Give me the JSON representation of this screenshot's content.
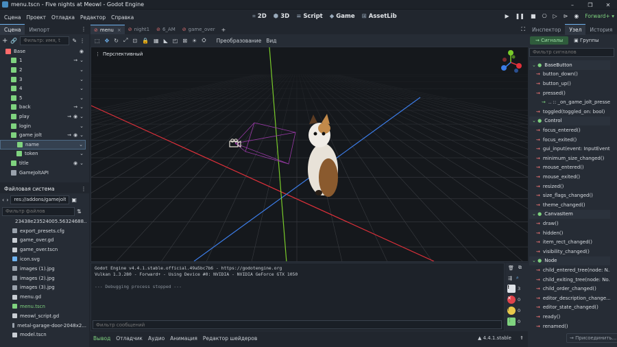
{
  "window": {
    "title": "menu.tscn - Five nights at Meowl - Godot Engine",
    "controls": [
      "–",
      "❐",
      "✕"
    ]
  },
  "menu": [
    "Сцена",
    "Проект",
    "Отладка",
    "Редактор",
    "Справка"
  ],
  "workspaces": [
    {
      "icon": "⌗",
      "label": "2D"
    },
    {
      "icon": "⬢",
      "label": "3D"
    },
    {
      "icon": "≡",
      "label": "Script"
    },
    {
      "icon": "◆",
      "label": "Game"
    },
    {
      "icon": "⊞",
      "label": "AssetLib"
    }
  ],
  "renderer": "Forward+",
  "scene_dock": {
    "tabs": [
      "Сцена",
      "Импорт"
    ],
    "filter_placeholder": "Фильтр: имя, t",
    "nodes": [
      {
        "label": "Base",
        "indent": 0,
        "color": "#ff6b6b",
        "sel": false
      },
      {
        "label": "1",
        "indent": 1,
        "color": "#7fd37f",
        "sel": false
      },
      {
        "label": "2",
        "indent": 1,
        "color": "#7fd37f",
        "sel": false
      },
      {
        "label": "3",
        "indent": 1,
        "color": "#7fd37f",
        "sel": false
      },
      {
        "label": "4",
        "indent": 1,
        "color": "#7fd37f",
        "sel": false
      },
      {
        "label": "5",
        "indent": 1,
        "color": "#7fd37f",
        "sel": false
      },
      {
        "label": "back",
        "indent": 1,
        "color": "#7fd37f",
        "sel": false
      },
      {
        "label": "play",
        "indent": 1,
        "color": "#7fd37f",
        "sel": false
      },
      {
        "label": "login",
        "indent": 1,
        "color": "#7fd37f",
        "sel": false
      },
      {
        "label": "game jolt",
        "indent": 1,
        "color": "#7fd37f",
        "sel": false
      },
      {
        "label": "name",
        "indent": 2,
        "color": "#7fd37f",
        "sel": true
      },
      {
        "label": "token",
        "indent": 2,
        "color": "#7fd37f",
        "sel": false
      },
      {
        "label": "title",
        "indent": 1,
        "color": "#7fd37f",
        "sel": false
      },
      {
        "label": "GameJoltAPI",
        "indent": 1,
        "color": "#9aa2ac",
        "sel": false
      }
    ]
  },
  "filesystem": {
    "title": "Файловая система",
    "path": "res://addons/gamejolt_api",
    "filter_placeholder": "Фильтр файлов",
    "files": [
      {
        "label": "23438e23524005.56324688...",
        "color": "#e06c75"
      },
      {
        "label": "export_presets.cfg",
        "color": "#9aa2ac"
      },
      {
        "label": "game_over.gd",
        "color": "#c9ced4"
      },
      {
        "label": "game_over.tscn",
        "color": "#c9ced4"
      },
      {
        "label": "icon.svg",
        "color": "#6fb3f0"
      },
      {
        "label": "images (1).jpg",
        "color": "#9aa2ac"
      },
      {
        "label": "images (2).jpg",
        "color": "#9aa2ac"
      },
      {
        "label": "images (3).jpg",
        "color": "#9aa2ac"
      },
      {
        "label": "menu.gd",
        "color": "#c9ced4"
      },
      {
        "label": "menu.tscn",
        "color": "#7fd37f"
      },
      {
        "label": "meowl_script.gd",
        "color": "#c9ced4"
      },
      {
        "label": "metal-garage-door-2048x2...",
        "color": "#9aa2ac"
      },
      {
        "label": "model.tscn",
        "color": "#c9ced4"
      }
    ]
  },
  "editor_tabs": [
    {
      "label": "menu",
      "active": true
    },
    {
      "label": "night1",
      "active": false
    },
    {
      "label": "6_AM",
      "active": false
    },
    {
      "label": "game_over",
      "active": false
    }
  ],
  "toolbar": {
    "transform": "Преобразование",
    "view": "Вид"
  },
  "viewport": {
    "label": "Перспективный"
  },
  "output": {
    "lines": [
      "Godot Engine v4.4.1.stable.official.49a5bc7b6 - https://godotengine.org",
      "Vulkan 1.3.280 - Forward+ - Using Device #0: NVIDIA - NVIDIA GeForce GTX 1050",
      "",
      "--- Debugging process stopped ---"
    ],
    "filter_placeholder": "Фильтр сообщений",
    "counts": [
      "3",
      "0",
      "0",
      "0"
    ]
  },
  "bottom_tabs": [
    "Вывод",
    "Отладчик",
    "Аудио",
    "Анимация",
    "Редактор шейдеров"
  ],
  "version": "4.4.1.stable",
  "inspector": {
    "tabs": [
      "Инспектор",
      "Узел",
      "История"
    ],
    "subtabs": [
      "Сигналы",
      "Группы"
    ],
    "filter_placeholder": "Фильтр сигналов",
    "rows": [
      {
        "t": "BaseButton",
        "h": true
      },
      {
        "t": "button_down()",
        "h": false
      },
      {
        "t": "button_up()",
        "h": false
      },
      {
        "t": "pressed()",
        "h": false
      },
      {
        "t": ".. :: _on_game_jolt_presse...",
        "h": false,
        "conn": true
      },
      {
        "t": "toggled(toggled_on: bool)",
        "h": false
      },
      {
        "t": "Control",
        "h": true
      },
      {
        "t": "focus_entered()",
        "h": false
      },
      {
        "t": "focus_exited()",
        "h": false
      },
      {
        "t": "gui_input(event: InputEvent)",
        "h": false
      },
      {
        "t": "minimum_size_changed()",
        "h": false
      },
      {
        "t": "mouse_entered()",
        "h": false
      },
      {
        "t": "mouse_exited()",
        "h": false
      },
      {
        "t": "resized()",
        "h": false
      },
      {
        "t": "size_flags_changed()",
        "h": false
      },
      {
        "t": "theme_changed()",
        "h": false
      },
      {
        "t": "CanvasItem",
        "h": true
      },
      {
        "t": "draw()",
        "h": false
      },
      {
        "t": "hidden()",
        "h": false
      },
      {
        "t": "item_rect_changed()",
        "h": false
      },
      {
        "t": "visibility_changed()",
        "h": false
      },
      {
        "t": "Node",
        "h": true
      },
      {
        "t": "child_entered_tree(node: N...",
        "h": false
      },
      {
        "t": "child_exiting_tree(node: No...",
        "h": false
      },
      {
        "t": "child_order_changed()",
        "h": false
      },
      {
        "t": "editor_description_change...",
        "h": false
      },
      {
        "t": "editor_state_changed()",
        "h": false
      },
      {
        "t": "ready()",
        "h": false
      },
      {
        "t": "renamed()",
        "h": false
      }
    ],
    "connect_label": "Присоединить..."
  }
}
